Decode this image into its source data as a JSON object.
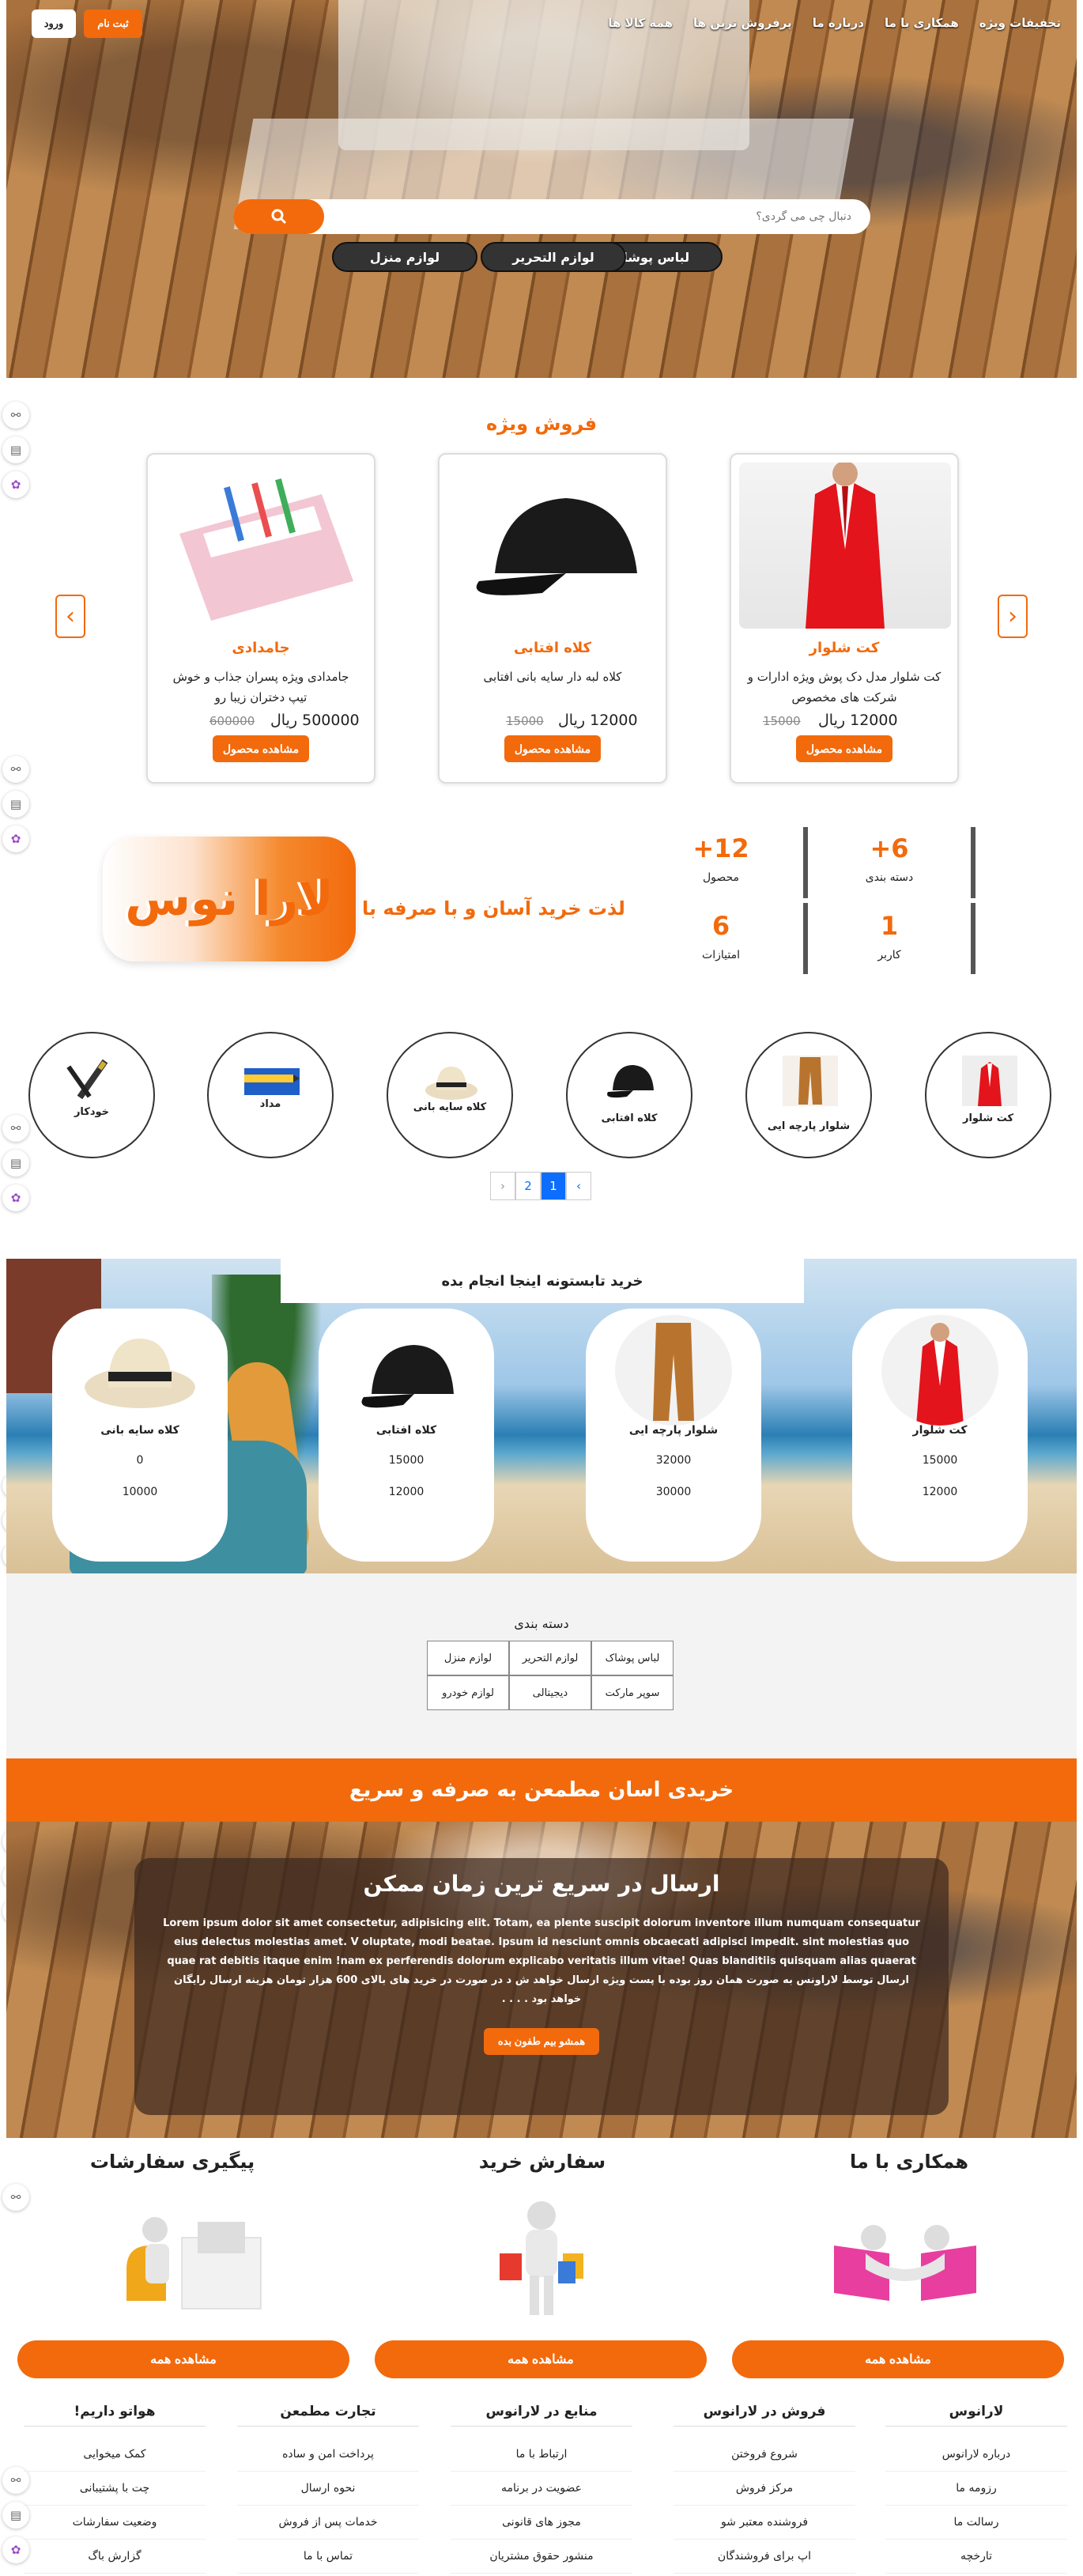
{
  "nav": {
    "links": [
      "تخفیفات ویژه",
      "همکاری با ما",
      "درباره ما",
      "پرفروش ترین ها",
      "همه کالا ها"
    ],
    "signup": "ثبت نام",
    "login": "ورود"
  },
  "hero": {
    "search_placeholder": "دنبال چی می گردی؟",
    "chips": [
      "لباس پوشاک",
      "لوازم التحریر",
      "لوازم منزل"
    ]
  },
  "special": {
    "title": "فروش ویژه",
    "products": [
      {
        "name": "کت شلوار",
        "desc": "کت شلوار مدل دک پوش ویژه ادارات و شرکت های مخصوص",
        "price": "12000 ریال",
        "old": "15000",
        "button": "مشاهده محصول"
      },
      {
        "name": "کلاه افتابی",
        "desc": "کلاه لبه دار سایه بانی افتابی",
        "price": "12000 ریال",
        "old": "15000",
        "button": "مشاهده محصول"
      },
      {
        "name": "جامدادی",
        "desc": "جامدادی ویژه پسران جذاب و خوش تیپ دختران زیبا رو",
        "price": "500000 ریال",
        "old": "600000",
        "button": "مشاهده محصول"
      }
    ]
  },
  "stats": {
    "items": [
      {
        "value": "+6",
        "label": "دسته بندی"
      },
      {
        "value": "+12",
        "label": "محصول"
      },
      {
        "value": "1",
        "label": "کاربر"
      },
      {
        "value": "6",
        "label": "امتیازات"
      }
    ],
    "tagline": "لذت خرید آسان و با صرفه با",
    "brand": "لارا نوس"
  },
  "circles": {
    "items": [
      "کت شلوار",
      "شلوار پارچه ایی",
      "کلاه افتابی",
      "کلاه سایه بانی",
      "مداد",
      "خودکار"
    ],
    "pages": [
      "‹",
      "1",
      "2",
      "›"
    ]
  },
  "summer": {
    "title": "خرید تابستونه اینجا انجام بده",
    "items": [
      {
        "name": "کت شلوار",
        "a": "15000",
        "b": "12000"
      },
      {
        "name": "شلوار پارچه ایی",
        "a": "32000",
        "b": "30000"
      },
      {
        "name": "کلاه افتابی",
        "a": "15000",
        "b": "12000"
      },
      {
        "name": "کلاه سایه بانی",
        "a": "0",
        "b": "10000"
      }
    ]
  },
  "categories": {
    "title": "دسته بندی",
    "items": [
      "لباس پوشاک",
      "لوازم التحریر",
      "لوازم منزل",
      "سوپر مارکت",
      "دیجیتالی",
      "لوازم خودرو"
    ]
  },
  "band": {
    "text": "خریدی اسان مطمعن به صرفه و سریع"
  },
  "shipping": {
    "title": "ارسال در سریع ترین زمان ممکن",
    "body": "Lorem ipsum dolor sit amet consectetur, adipisicing elit. Totam, ea plente suscipit dolorum inventore illum numquam consequatur eius delectus molestias amet. V oluptate, modi beatae. Ipsum id nesciunt omnis obcaecati adipisci impedit. sint molestias quo quae rat debitis itaque enim !nam ex perferendis dolorum explicabo veritatis illum vitae! Quas blanditiis quisquam alias quaerat ارسال توسط لاراونس به صورت همان روز بوده با پست ویژه ارسال خواهد ش د در صورت در خرید های بالای 600 هزار تومان هزینه ارسال رایگان خواهد بود . . . .",
    "button": "همشو بیم طفون بده"
  },
  "three": [
    {
      "title": "همکاری با ما",
      "button": "مشاهده همه"
    },
    {
      "title": "سفارش خرید",
      "button": "مشاهده همه"
    },
    {
      "title": "پیگیری سفارشات",
      "button": "مشاهده همه"
    }
  ],
  "footer": [
    {
      "title": "لارانوس",
      "items": [
        "درباره لارانوس",
        "رزومه ما",
        "رسالت ما",
        "تارخچه"
      ]
    },
    {
      "title": "فروش در لارانوس",
      "items": [
        "شروع فروختن",
        "مرکز فروش",
        "فروشنده معتبر شو",
        "اپ برای فروشندگان"
      ]
    },
    {
      "title": "منابع در لارانوس",
      "items": [
        "ارتباط با ما",
        "عضویت در برنامه",
        "مجوز های قانونی",
        "منشور حقوق مشتریان"
      ]
    },
    {
      "title": "تجارت مطمعن",
      "items": [
        "پرداخت امن و ساده",
        "نحوه ارسال",
        "خدمات پس از فروش",
        "تماس با ما"
      ]
    },
    {
      "title": "هواتو داریم!",
      "items": [
        "کمک میخوایی",
        "چت با پشتیبانی",
        "وضعیت سفارشات",
        "گزارش باگ"
      ]
    }
  ]
}
